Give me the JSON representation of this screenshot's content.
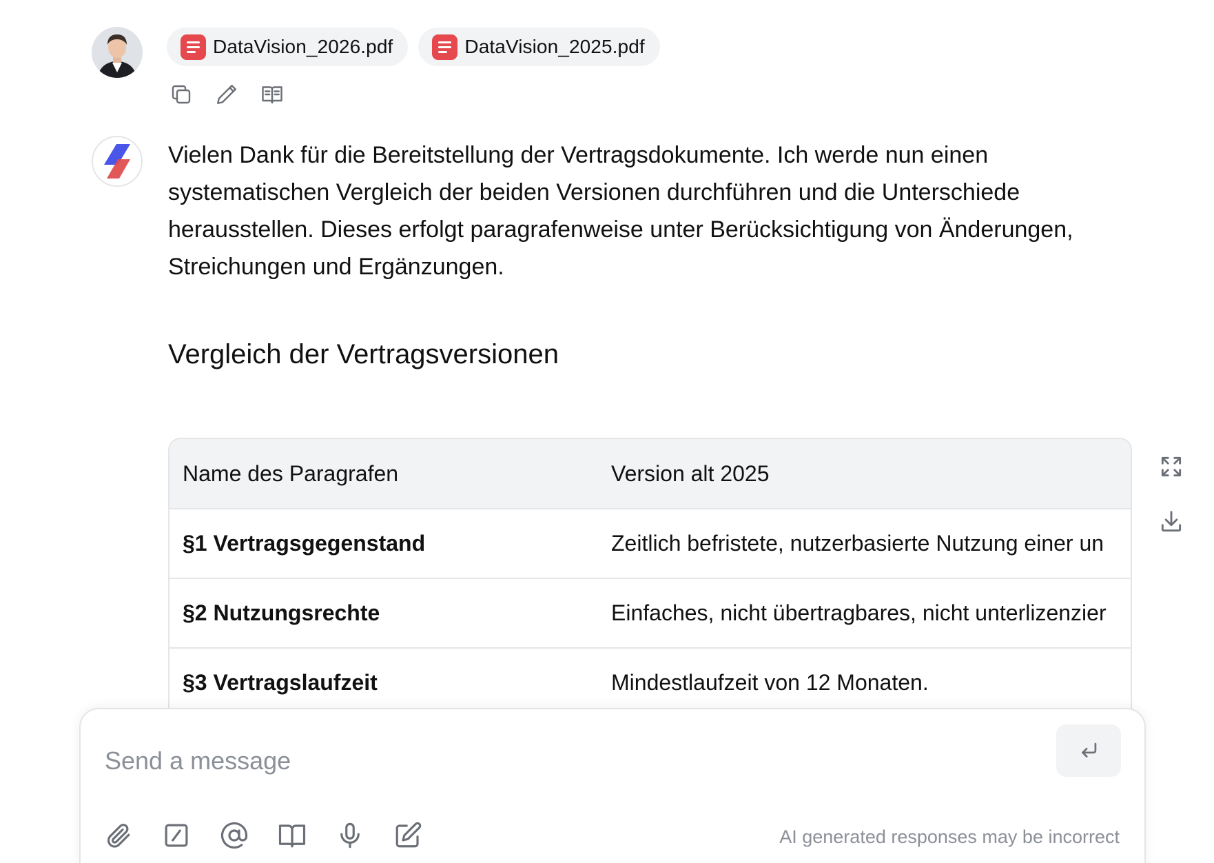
{
  "user_message": {
    "attachments": [
      {
        "name": "DataVision_2026.pdf",
        "icon": "pdf-file-icon"
      },
      {
        "name": "DataVision_2025.pdf",
        "icon": "pdf-file-icon"
      }
    ],
    "actions": [
      "copy-icon",
      "pencil-icon",
      "book-open-icon"
    ]
  },
  "assistant_message": {
    "text": "Vielen Dank für die Bereitstellung der Vertragsdokumente. Ich werde nun einen systematischen Vergleich der beiden Versionen durchführen und die Unterschiede herausstellen. Dieses erfolgt paragrafenweise unter Berücksichtigung von Änderungen, Streichungen und Ergänzungen.",
    "heading": "Vergleich der Vertragsversionen",
    "table": {
      "headers": [
        "Name des Paragrafen",
        "Version alt 2025"
      ],
      "rows": [
        [
          "§1 Vertragsgegenstand",
          "Zeitlich befristete, nutzerbasierte Nutzung einer un"
        ],
        [
          "§2 Nutzungsrechte",
          "Einfaches, nicht übertragbares, nicht unterlizenzier"
        ],
        [
          "§3 Vertragslaufzeit",
          "Mindestlaufzeit von 12 Monaten."
        ]
      ]
    },
    "table_tools": [
      "expand-icon",
      "download-icon"
    ]
  },
  "composer": {
    "placeholder": "Send a message",
    "value": "",
    "disclaimer": "AI generated responses may be incorrect",
    "tools": [
      "paperclip-icon",
      "slash-command-icon",
      "at-mention-icon",
      "book-icon",
      "microphone-icon",
      "compose-icon"
    ],
    "send_icon": "enter-return-icon"
  },
  "colors": {
    "pdf_icon": "#e5484d",
    "chip_bg": "#f2f3f5",
    "table_header_bg": "#f2f3f5",
    "border": "#e3e5e8",
    "muted_text": "#8b8f97",
    "logo_blue": "#4a56e8",
    "logo_red": "#e04a4a"
  }
}
